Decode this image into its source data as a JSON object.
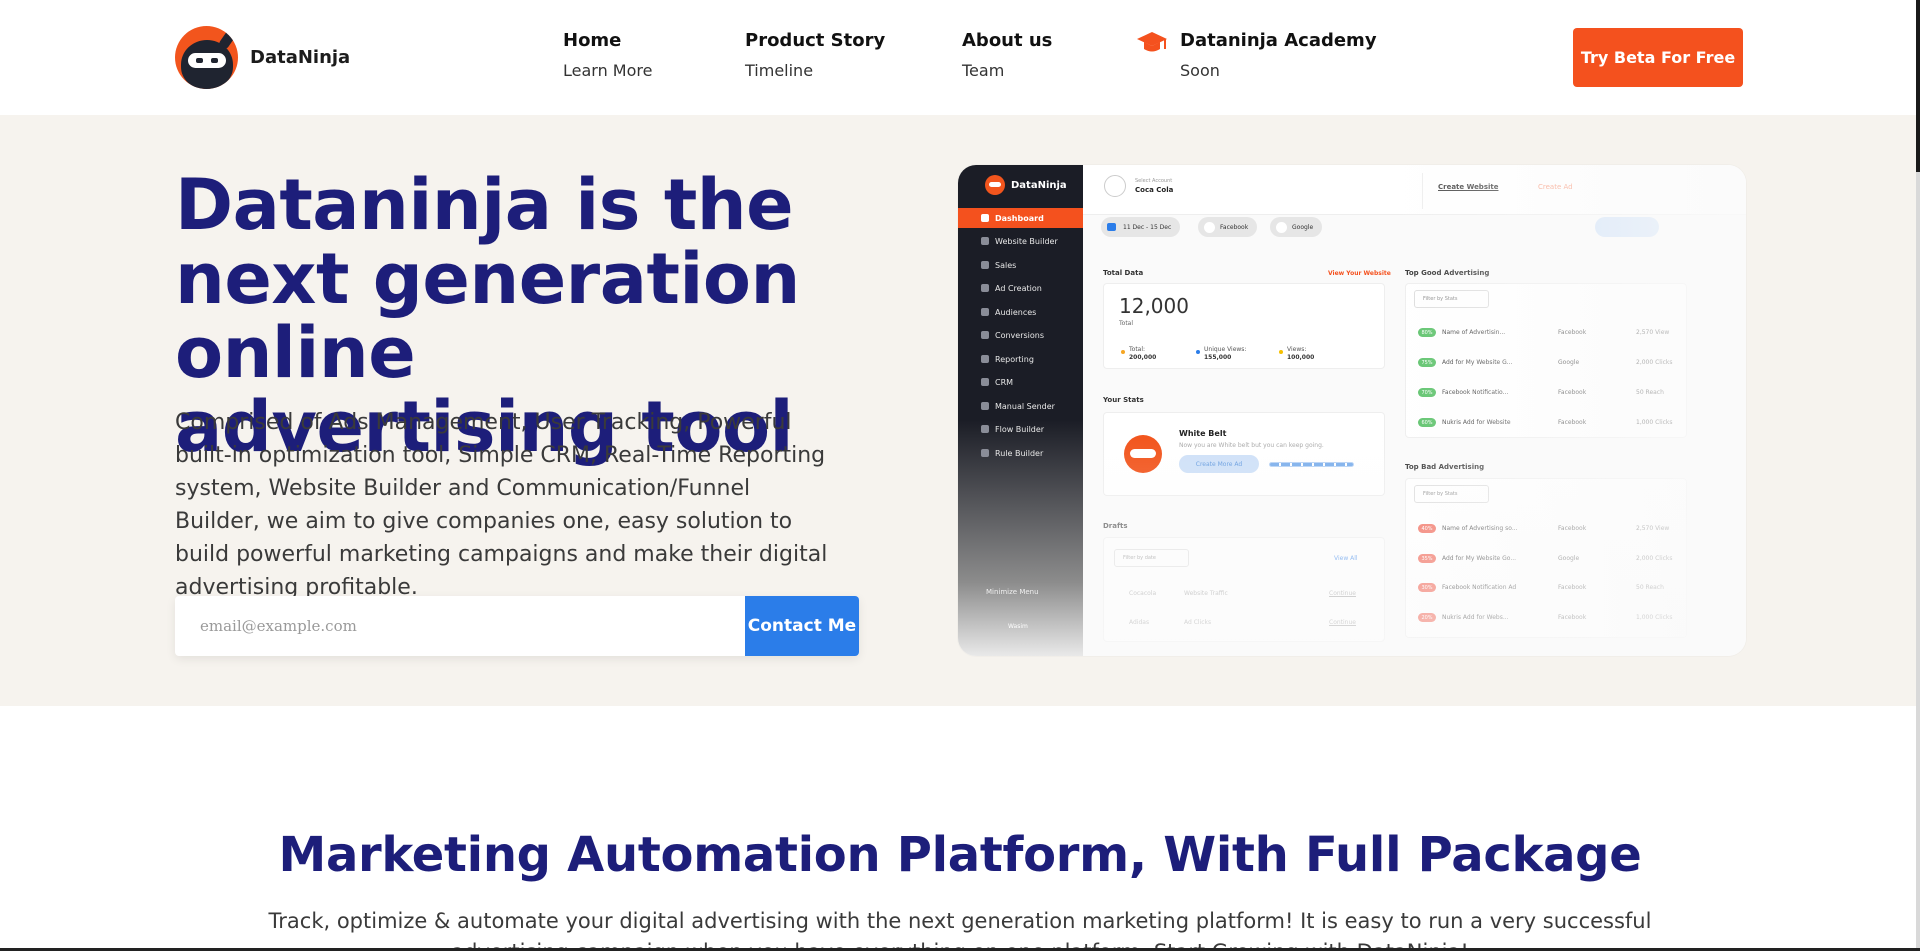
{
  "header": {
    "logo_text": "DataNinja",
    "nav": [
      {
        "title": "Home",
        "sub": "Learn More"
      },
      {
        "title": "Product Story",
        "sub": "Timeline"
      },
      {
        "title": "About us",
        "sub": "Team"
      },
      {
        "title": "Dataninja Academy",
        "sub": "Soon",
        "icon": "graduation-cap-icon"
      }
    ],
    "cta": "Try Beta For Free"
  },
  "hero": {
    "title": "Dataninja is the next generation online advertising tool",
    "description": "Comprised of Ads Management, User Tracking, Powerful built-in optimization tool, Simple CRM, Real-Time Reporting system, Website Builder and Communication/Funnel Builder, we aim to give companies one, easy solution to build powerful marketing campaigns and make their digital advertising profitable.",
    "email_placeholder": "email@example.com",
    "contact_button": "Contact Me"
  },
  "mockup": {
    "brand": "DataNinja",
    "sidebar": [
      "Dashboard",
      "Website Builder",
      "Sales",
      "Ad Creation",
      "Audiences",
      "Conversions",
      "Reporting",
      "CRM",
      "Manual Sender",
      "Flow Builder",
      "Rule Builder"
    ],
    "minimize": "Minimize Menu",
    "user": "Wasim",
    "account_label": "Select Account",
    "account_name": "Coca Cola",
    "create_website": "Create Website",
    "create_ad": "Create Ad",
    "chips": [
      "11 Dec - 15 Dec",
      "Facebook",
      "Google"
    ],
    "total_data_label": "Total Data",
    "view_website": "View Your Website",
    "total_value": "12,000",
    "total_sub": "Total",
    "stats": [
      {
        "label": "Total:",
        "value": "200,000",
        "color": "#f5a623"
      },
      {
        "label": "Unique Views:",
        "value": "155,000",
        "color": "#2b7de9"
      },
      {
        "label": "Views:",
        "value": "100,000",
        "color": "#f5c000"
      }
    ],
    "your_stats": "Your Stats",
    "belt_title": "White Belt",
    "belt_sub": "Now you are White belt but you can keep going.",
    "belt_button": "Create More Ad",
    "drafts": "Drafts",
    "filter_date": "Filter by date",
    "filter_stats": "Filter by Stats",
    "view_all": "View All",
    "draft_rows": [
      {
        "a": "Cocacola",
        "b": "Website Traffic",
        "c": "Continue"
      },
      {
        "a": "Adidas",
        "b": "Ad Clicks",
        "c": "Continue"
      }
    ],
    "top_good": "Top Good Advertising",
    "top_bad": "Top Bad Advertising",
    "good_ads": [
      {
        "pct": "80%",
        "name": "Name of Advertisin...",
        "platform": "Facebook",
        "value": "2,570 View"
      },
      {
        "pct": "75%",
        "name": "Add for My Website G...",
        "platform": "Google",
        "value": "2,000 Clicks"
      },
      {
        "pct": "70%",
        "name": "Facebook Notificatio...",
        "platform": "Facebook",
        "value": "50 Reach"
      },
      {
        "pct": "60%",
        "name": "Nukris Add for Website",
        "platform": "Facebook",
        "value": "1,000 Clicks"
      }
    ],
    "bad_ads": [
      {
        "pct": "40%",
        "name": "Name of Advertising so...",
        "platform": "Facebook",
        "value": "2,570 View"
      },
      {
        "pct": "35%",
        "name": "Add for My Website Go...",
        "platform": "Google",
        "value": "2,000 Clicks"
      },
      {
        "pct": "30%",
        "name": "Facebook Notification Ad",
        "platform": "Facebook",
        "value": "50 Reach"
      },
      {
        "pct": "20%",
        "name": "Nukris Add for Webs...",
        "platform": "Facebook",
        "value": "1,000 Clicks"
      }
    ]
  },
  "section2": {
    "title": "Marketing Automation Platform, With Full Package",
    "description": "Track, optimize & automate your digital advertising with the next generation marketing platform! It is easy to run a very successful advertising campaign when you have everything on one platform. Start Growing with DataNinja!"
  },
  "colors": {
    "brand_orange": "#f4511e",
    "navy": "#1d1e7a",
    "button_blue": "#2b7de9",
    "hero_bg": "#f6f3ee"
  }
}
